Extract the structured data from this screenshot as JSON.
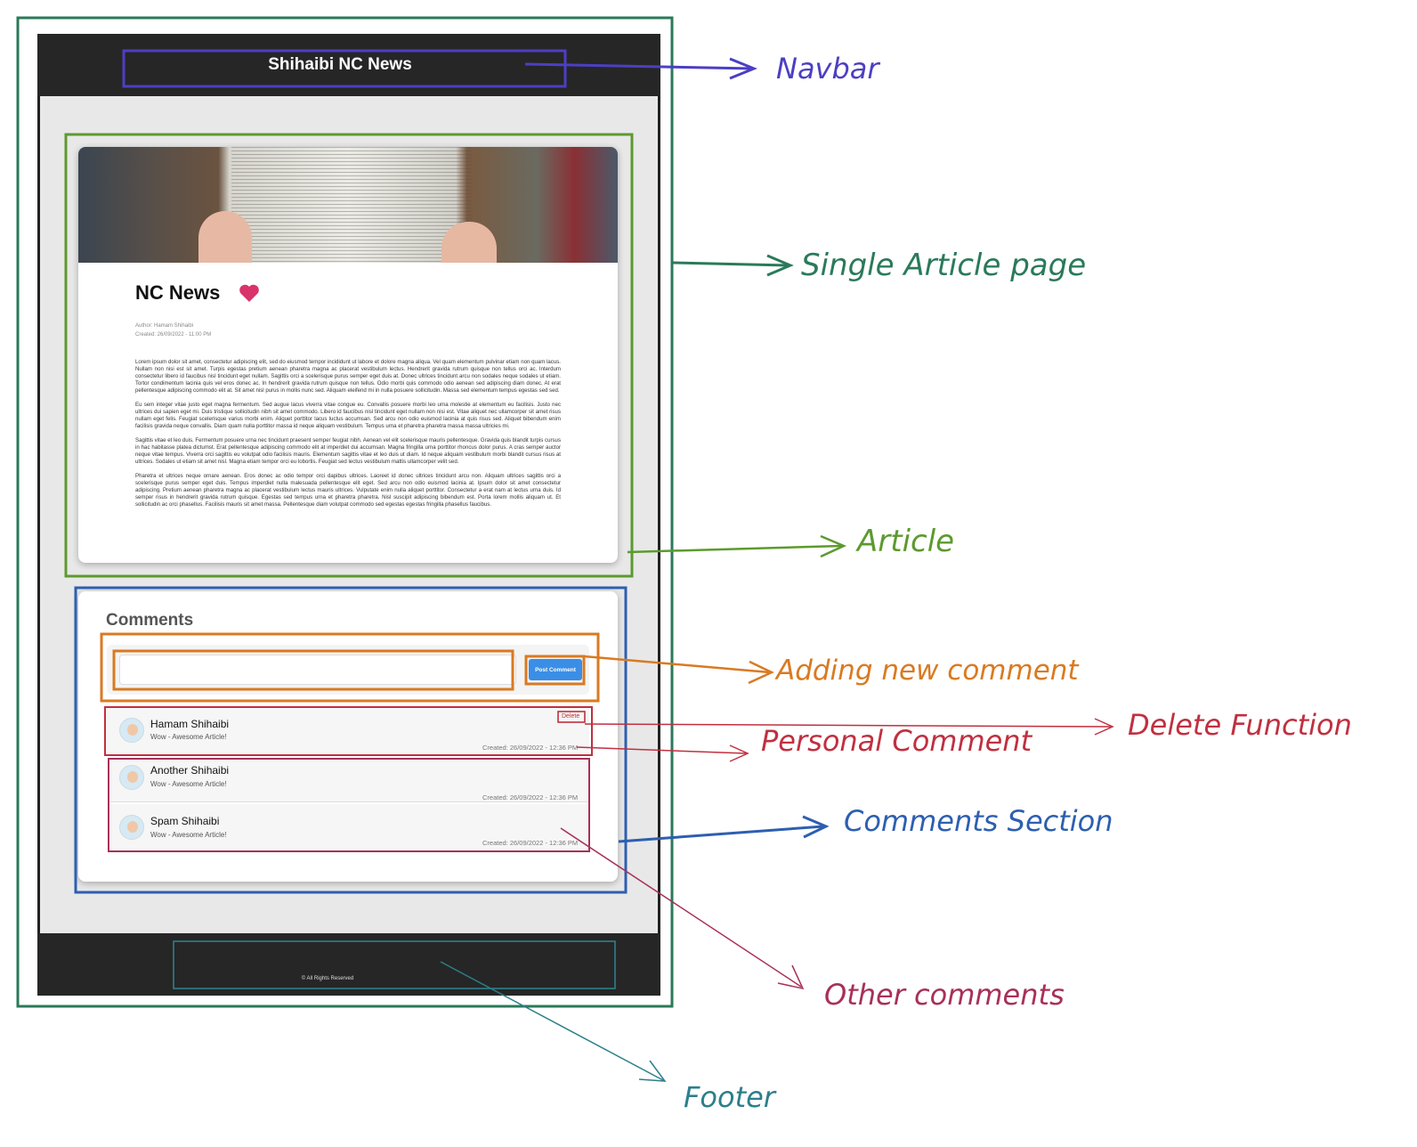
{
  "mockup": {
    "navbar_title": "Shihaibi NC News",
    "article": {
      "title": "NC News",
      "author": "Author: Hamam Shihaibi",
      "created": "Created: 26/09/2022 - 11:00 PM",
      "paragraphs": [
        "Lorem ipsum dolor sit amet, consectetur adipiscing elit, sed do eiusmod tempor incididunt ut labore et dolore magna aliqua. Vel quam elementum pulvinar etiam non quam lacus. Nullam non nisi est sit amet. Turpis egestas pretium aenean pharetra magna ac placerat vestibulum lectus. Hendrerit gravida rutrum quisque non tellus orci ac. Interdum consectetur libero id faucibus nisl tincidunt eget nullam. Sagittis orci a scelerisque purus semper eget duis at. Donec ultrices tincidunt arcu non sodales neque sodales ut etiam. Tortor condimentum lacinia quis vel eros donec ac. In hendrerit gravida rutrum quisque non tellus. Odio morbi quis commodo odio aenean sed adipiscing diam donec. At erat pellentesque adipiscing commodo elit at. Sit amet nisl purus in mollis nunc sed. Aliquam eleifend mi in nulla posuere sollicitudin. Massa sed elementum tempus egestas sed sed.",
        "Eu sem integer vitae justo eget magna fermentum. Sed augue lacus viverra vitae congue eu. Convallis posuere morbi leo urna molestie at elementum eu facilisis. Justo nec ultrices dui sapien eget mi. Duis tristique sollicitudin nibh sit amet commodo. Libero id faucibus nisl tincidunt eget nullam non nisi est. Vitae aliquet nec ullamcorper sit amet risus nullam eget felis. Feugiat scelerisque varius morbi enim. Aliquet porttitor lacus luctus accumsan. Sed arcu non odio euismod lacinia at quis risus sed. Aliquet bibendum enim facilisis gravida neque convallis. Diam quam nulla porttitor massa id neque aliquam vestibulum. Tempus urna et pharetra pharetra massa massa ultricies mi.",
        "Sagittis vitae et leo duis. Fermentum posuere urna nec tincidunt praesent semper feugiat nibh. Aenean vel elit scelerisque mauris pellentesque. Gravida quis blandit turpis cursus in hac habitasse platea dictumst. Erat pellentesque adipiscing commodo elit at imperdiet dui accumsan. Magna fringilla urna porttitor rhoncus dolor purus. A cras semper auctor neque vitae tempus. Viverra orci sagittis eu volutpat odio facilisis mauris. Elementum sagittis vitae et leo duis ut diam. Id neque aliquam vestibulum morbi blandit cursus risus at ultrices. Sodales ut etiam sit amet nisl. Magna etiam tempor orci eu lobortis. Feugiat sed lectus vestibulum mattis ullamcorper velit sed.",
        "Pharetra et ultrices neque ornare aenean. Eros donec ac odio tempor orci dapibus ultrices. Laoreet id donec ultrices tincidunt arcu non. Aliquam ultrices sagittis orci a scelerisque purus semper eget duis. Tempus imperdiet nulla malesuada pellentesque elit eget. Sed arcu non odio euismod lacinia at. Ipsum dolor sit amet consectetur adipiscing. Pretium aenean pharetra magna ac placerat vestibulum lectus mauris ultrices. Vulputate enim nulla aliquet porttitor. Consectetur a erat nam at lectus urna duis. Id semper risus in hendrerit gravida rutrum quisque. Egestas sed tempus urna et pharetra pharetra. Nisl suscipit adipiscing bibendum est. Porta lorem mollis aliquam ut. Et sollicitudin ac orci phasellus. Facilisis mauris sit amet massa. Pellentesque diam volutpat commodo sed egestas egestas fringilla phasellus faucibus."
      ]
    },
    "comments": {
      "title": "Comments",
      "input_value": "",
      "post_button": "Post Comment",
      "delete_label": "Delete",
      "items": [
        {
          "author": "Hamam Shihaibi",
          "text": "Wow - Awesome Article!",
          "created": "Created: 26/09/2022 - 12:36 PM"
        },
        {
          "author": "Another Shihaibi",
          "text": "Wow - Awesome Article!",
          "created": "Created: 26/09/2022 - 12:36 PM"
        },
        {
          "author": "Spam Shihaibi",
          "text": "Wow - Awesome Article!",
          "created": "Created: 26/09/2022 - 12:36 PM"
        }
      ]
    },
    "footer_text": "© All Rights Reserved"
  },
  "annotations": {
    "navbar": "Navbar",
    "single_article_page": "Single Article page",
    "article": "Article",
    "adding_new_comment": "Adding new comment",
    "delete_function": "Delete Function",
    "personal_comment": "Personal Comment",
    "comments_section": "Comments Section",
    "other_comments": "Other comments",
    "footer": "Footer"
  },
  "colors": {
    "navbar": "#4b3fc4",
    "page": "#2a7a5a",
    "article": "#5c9a2e",
    "adding": "#d97a22",
    "red": "#c03040",
    "comments_section": "#2d5fb0",
    "other": "#a8305a",
    "footer": "#2d7f8a"
  }
}
